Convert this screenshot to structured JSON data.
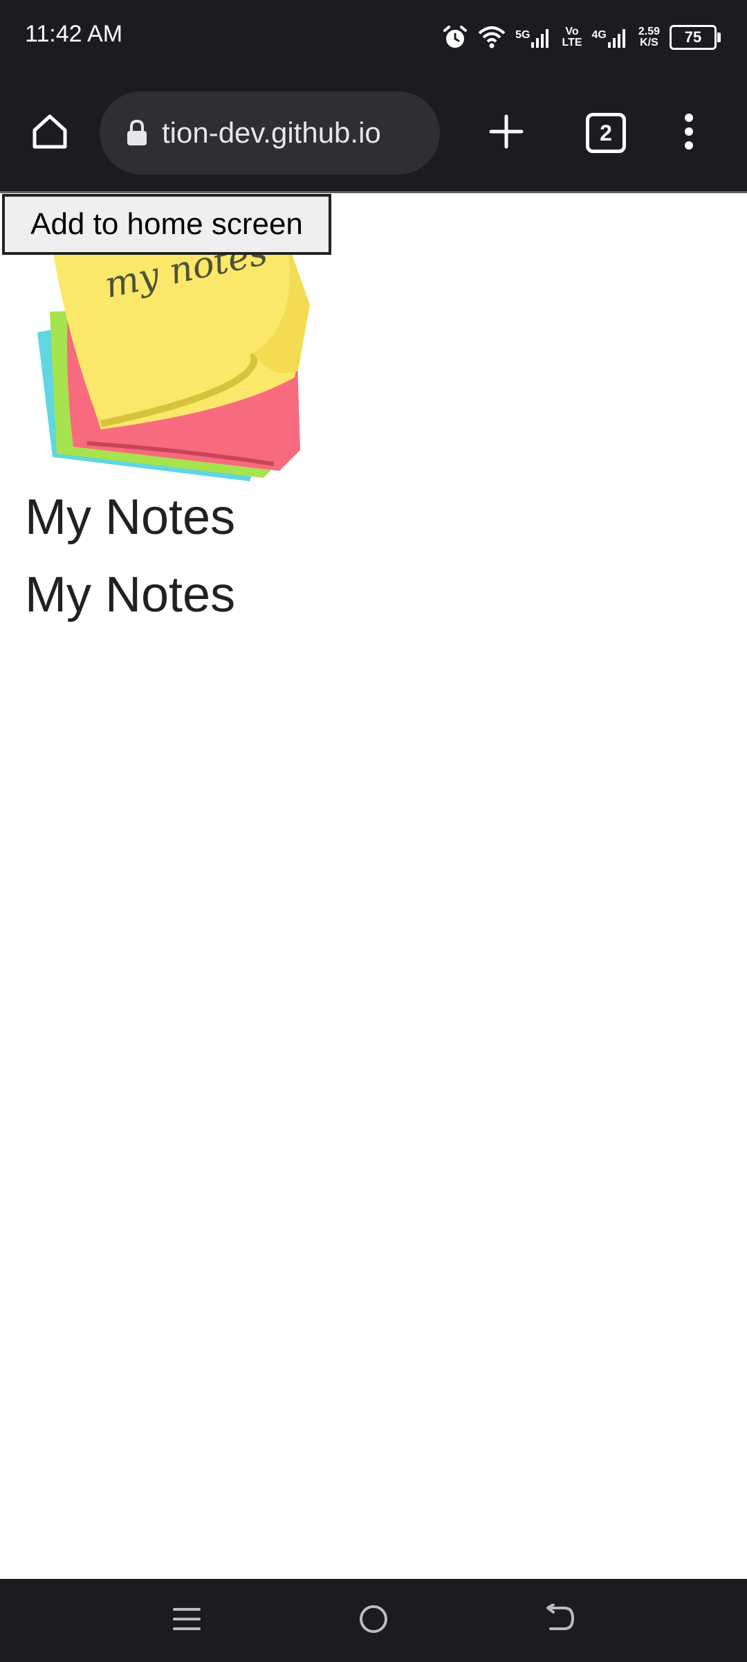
{
  "status_bar": {
    "time": "11:42 AM",
    "network_5g": "5G",
    "volte_top": "Vo",
    "volte_bottom": "LTE",
    "network_4g": "4G",
    "speed_value": "2.59",
    "speed_unit": "K/S",
    "battery": "75",
    "icons": [
      "alarm-icon",
      "wifi-icon",
      "signal-5g-icon",
      "volte-icon",
      "signal-4g-icon",
      "battery-icon"
    ]
  },
  "browser": {
    "url": "tion-dev.github.io",
    "tab_count": "2",
    "icons": [
      "home-icon",
      "lock-icon",
      "plus-icon",
      "tabs-icon",
      "more-vert-icon"
    ]
  },
  "page": {
    "add_to_home_label": "Add to home screen",
    "logo_text": "my notes",
    "heading_1": "My Notes",
    "heading_2": "My Notes",
    "colors": {
      "note_yellow": "#fbe86a",
      "note_pink": "#f86a7e",
      "note_green": "#a6e34e",
      "note_cyan": "#5fd6e0"
    }
  },
  "nav_bar": {
    "icons": [
      "menu-icon",
      "circle-home-icon",
      "back-icon"
    ]
  },
  "theme": {
    "bar_background": "#1c1b1f",
    "url_pill": "#2f2f33"
  }
}
